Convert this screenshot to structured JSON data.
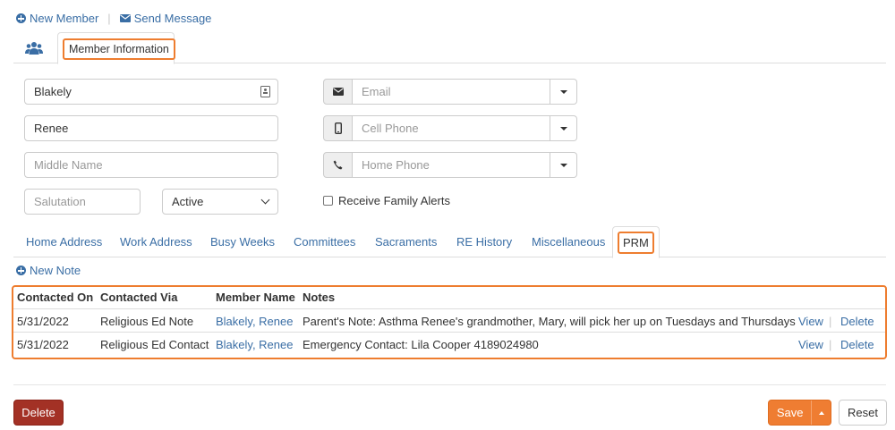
{
  "top_actions": {
    "new_member": "New Member",
    "send_message": "Send Message"
  },
  "main_tabs": {
    "member_info": "Member Information"
  },
  "form": {
    "last_name": "Blakely",
    "first_name": "Renee",
    "middle_name_placeholder": "Middle Name",
    "salutation_placeholder": "Salutation",
    "status": "Active",
    "email_placeholder": "Email",
    "cell_phone_placeholder": "Cell Phone",
    "home_phone_placeholder": "Home Phone",
    "receive_family_alerts": "Receive Family Alerts"
  },
  "sub_tabs": [
    "Home Address",
    "Work Address",
    "Busy Weeks",
    "Committees",
    "Sacraments",
    "RE History",
    "Miscellaneous",
    "PRM"
  ],
  "prm": {
    "new_note": "New Note",
    "headers": [
      "Contacted On",
      "Contacted Via",
      "Member Name",
      "Notes"
    ],
    "rows": [
      {
        "date": "5/31/2022",
        "via": "Religious Ed Note",
        "member": "Blakely, Renee",
        "notes": "Parent's Note: Asthma Renee's grandmother, Mary, will pick her up on Tuesdays and Thursdays",
        "view": "View",
        "delete": "Delete"
      },
      {
        "date": "5/31/2022",
        "via": "Religious Ed Contact",
        "member": "Blakely, Renee",
        "notes": "Emergency Contact: Lila Cooper 4189024980",
        "view": "View",
        "delete": "Delete"
      }
    ]
  },
  "footer": {
    "delete": "Delete",
    "save": "Save",
    "reset": "Reset"
  },
  "colors": {
    "link": "#3a6ea5",
    "accent": "#ee7d2f",
    "danger": "#a33125",
    "save": "#ef7d32"
  }
}
